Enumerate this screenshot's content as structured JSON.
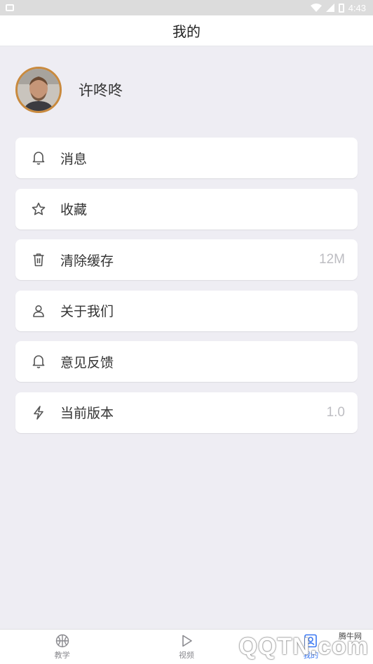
{
  "status_bar": {
    "time": "4:43"
  },
  "header": {
    "title": "我的"
  },
  "profile": {
    "name": "许咚咚"
  },
  "menu": {
    "items": [
      {
        "label": "消息",
        "icon": "bell-icon",
        "value": ""
      },
      {
        "label": "收藏",
        "icon": "star-icon",
        "value": ""
      },
      {
        "label": "清除缓存",
        "icon": "trash-icon",
        "value": "12M"
      },
      {
        "label": "关于我们",
        "icon": "user-icon",
        "value": ""
      },
      {
        "label": "意见反馈",
        "icon": "bell-icon",
        "value": ""
      },
      {
        "label": "当前版本",
        "icon": "lightning-icon",
        "value": "1.0"
      }
    ]
  },
  "tabbar": {
    "tabs": [
      {
        "label": "教学",
        "icon": "basketball-icon"
      },
      {
        "label": "视频",
        "icon": "play-icon"
      },
      {
        "label": "我的",
        "icon": "profile-icon",
        "active": true
      }
    ]
  },
  "watermark": {
    "text": "QQTN.com",
    "small": "腾牛网"
  },
  "colors": {
    "accent": "#3a78f2",
    "background": "#eeedf3",
    "avatar_ring": "#c98a3e"
  }
}
